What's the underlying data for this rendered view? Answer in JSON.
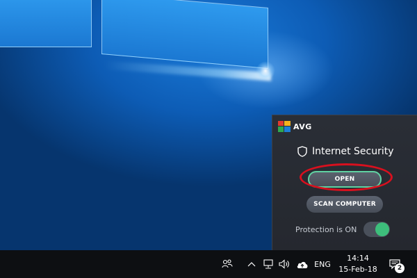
{
  "popup": {
    "brand": "AVG",
    "product_title": "Internet Security",
    "open_label": "OPEN",
    "scan_label": "SCAN COMPUTER",
    "protection_label": "Protection is ON",
    "protection_on": true,
    "accent_color": "#3dbe7b",
    "highlight_color": "#d8101e"
  },
  "taskbar": {
    "language": "ENG",
    "time": "14:14",
    "date": "15-Feb-18",
    "notification_count": "2",
    "icons": [
      "people-icon",
      "chevron-up-icon",
      "network-icon",
      "volume-icon",
      "cloud-upload-icon",
      "action-center-icon"
    ]
  }
}
